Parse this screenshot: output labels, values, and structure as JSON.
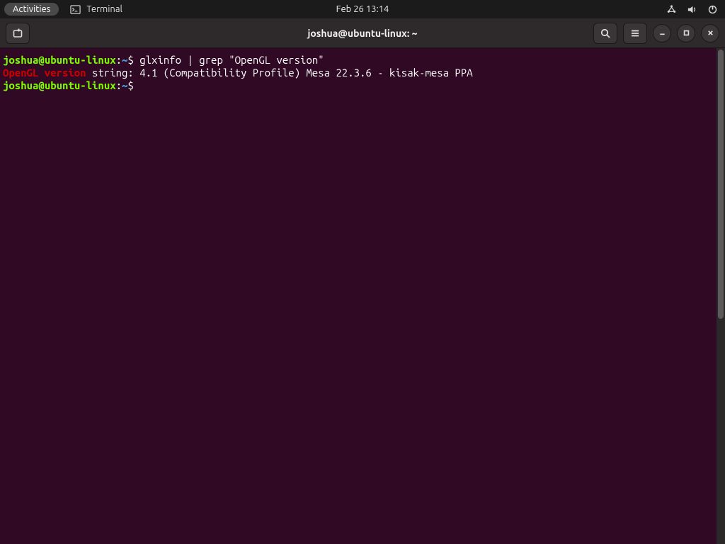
{
  "panel": {
    "activities_label": "Activities",
    "app_label": "Terminal",
    "clock": "Feb 26  13:14"
  },
  "window": {
    "title": "joshua@ubuntu-linux: ~"
  },
  "prompt": {
    "user": "joshua",
    "at": "@",
    "host": "ubuntu-linux",
    "colon": ":",
    "path": "~",
    "symbol": "$"
  },
  "terminal": {
    "line1_cmd": " glxinfo | grep \"OpenGL version\"",
    "line2_match": "OpenGL version",
    "line2_rest": " string: 4.1 (Compatibility Profile) Mesa 22.3.6 - kisak-mesa PPA",
    "line3_cmd": ""
  }
}
